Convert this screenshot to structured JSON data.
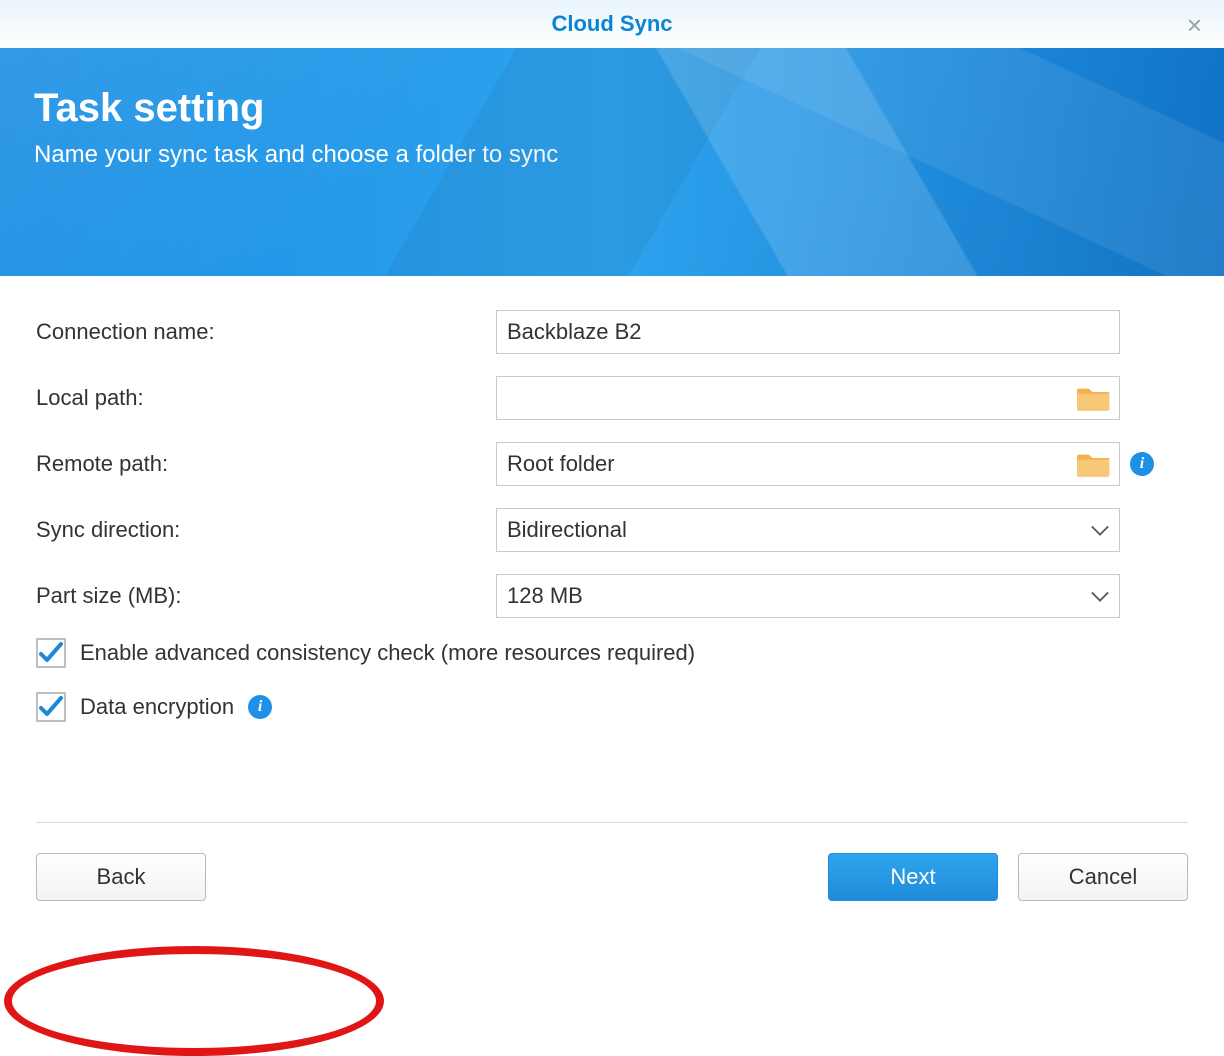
{
  "titlebar": {
    "title": "Cloud Sync"
  },
  "banner": {
    "heading": "Task setting",
    "subheading": "Name your sync task and choose a folder to sync"
  },
  "form": {
    "connection_name": {
      "label": "Connection name:",
      "value": "Backblaze B2"
    },
    "local_path": {
      "label": "Local path:",
      "value": ""
    },
    "remote_path": {
      "label": "Remote path:",
      "value": "Root folder"
    },
    "sync_direction": {
      "label": "Sync direction:",
      "value": "Bidirectional"
    },
    "part_size": {
      "label": "Part size (MB):",
      "value": "128 MB"
    },
    "consistency_check": {
      "label": "Enable advanced consistency check (more resources required)",
      "checked": true
    },
    "data_encryption": {
      "label": "Data encryption",
      "checked": true
    }
  },
  "footer": {
    "back": "Back",
    "next": "Next",
    "cancel": "Cancel"
  }
}
